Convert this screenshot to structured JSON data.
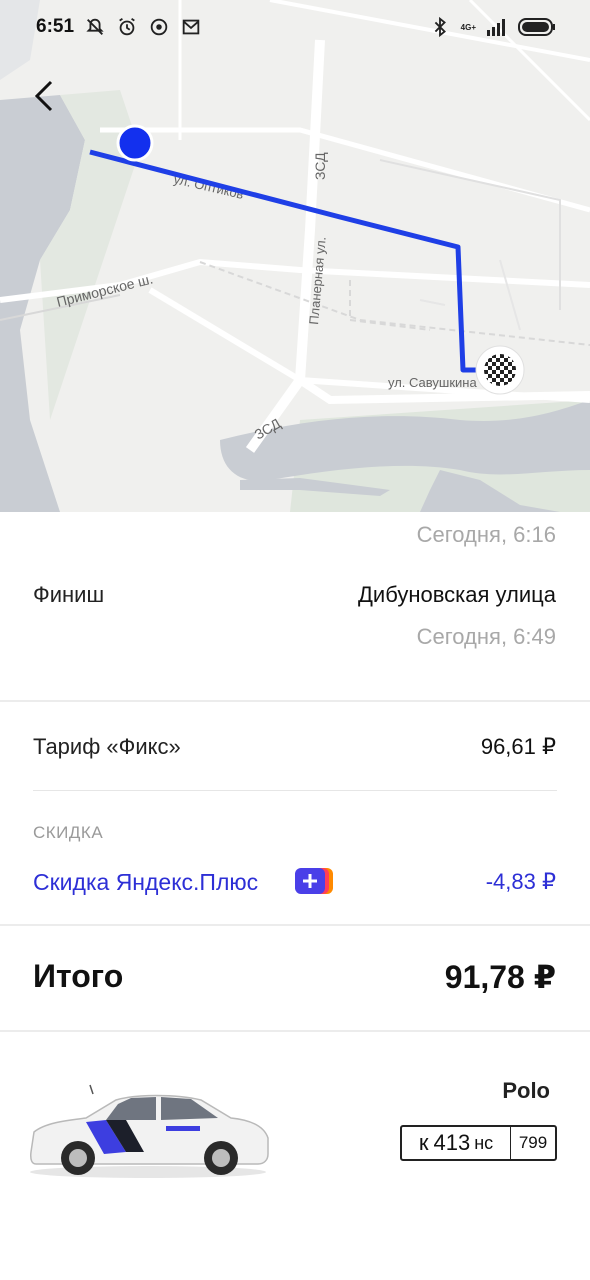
{
  "status_bar": {
    "time": "6:51",
    "network": "4G+",
    "icons": [
      "mute-bell-icon",
      "alarm-icon",
      "app-icon",
      "mail-icon",
      "bluetooth-icon",
      "signal-icon",
      "battery-icon"
    ]
  },
  "map": {
    "streets": {
      "opticov": "ул. Оптиков",
      "zsd_top": "ЗСД",
      "planernaya": "Планерная ул.",
      "primorskoe": "Приморское ш.",
      "savushkina": "ул. Савушкина",
      "zsd_bottom": "ЗСД"
    },
    "route_color": "#1f3fe6",
    "start_marker_color": "#1330ee"
  },
  "trip": {
    "start_time": "Сегодня, 6:16",
    "finish_label": "Финиш",
    "finish_address": "Дибуновская улица",
    "finish_time": "Сегодня, 6:49"
  },
  "pricing": {
    "tariff_label": "Тариф «Фикс»",
    "tariff_value": "96,61 ₽",
    "discount_caption": "СКИДКА",
    "discount_label": "Скидка Яндекс.Плюс",
    "discount_value": "-4,83 ₽",
    "total_label": "Итого",
    "total_value": "91,78 ₽"
  },
  "car": {
    "model": "Polo",
    "plate_letter": "к",
    "plate_number": "413",
    "plate_suffix": "нс",
    "plate_region": "799"
  },
  "colors": {
    "accent": "#2d2fd6",
    "muted": "#a8a8a8"
  }
}
